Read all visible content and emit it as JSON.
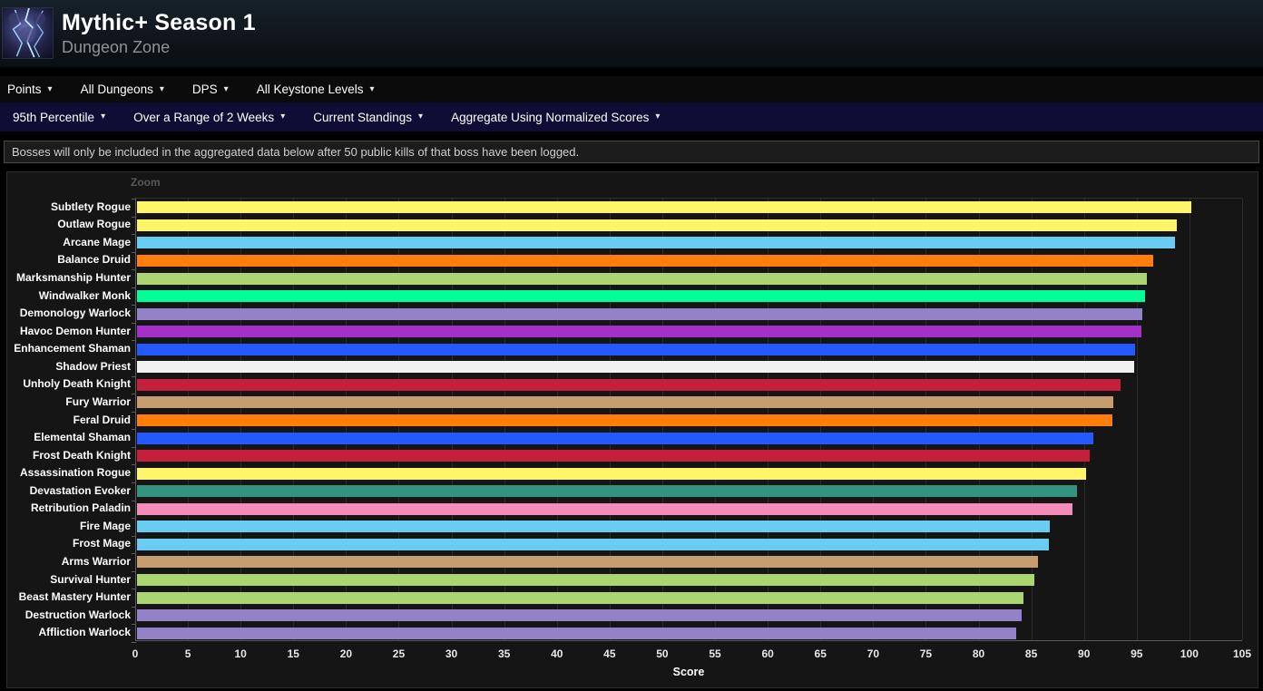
{
  "header": {
    "title": "Mythic+ Season 1",
    "subtitle": "Dungeon Zone"
  },
  "filters_row1": [
    {
      "label": "Points"
    },
    {
      "label": "All Dungeons"
    },
    {
      "label": "DPS"
    },
    {
      "label": "All Keystone Levels"
    }
  ],
  "filters_row2": [
    {
      "label": "95th Percentile"
    },
    {
      "label": "Over a Range of 2 Weeks"
    },
    {
      "label": "Current Standings"
    },
    {
      "label": "Aggregate Using Normalized Scores"
    }
  ],
  "notice": "Bosses will only be included in the aggregated data below after 50 public kills of that boss have been logged.",
  "chart": {
    "zoom_label": "Zoom"
  },
  "chart_data": {
    "type": "bar",
    "orientation": "horizontal",
    "title": "",
    "xlabel": "Score",
    "xlim": [
      0,
      105
    ],
    "xticks": [
      0,
      5,
      10,
      15,
      20,
      25,
      30,
      35,
      40,
      45,
      50,
      55,
      60,
      65,
      70,
      75,
      80,
      85,
      90,
      95,
      100,
      105
    ],
    "grid": true,
    "categories": [
      "Subtlety Rogue",
      "Outlaw Rogue",
      "Arcane Mage",
      "Balance Druid",
      "Marksmanship Hunter",
      "Windwalker Monk",
      "Demonology Warlock",
      "Havoc Demon Hunter",
      "Enhancement Shaman",
      "Shadow Priest",
      "Unholy Death Knight",
      "Fury Warrior",
      "Feral Druid",
      "Elemental Shaman",
      "Frost Death Knight",
      "Assassination Rogue",
      "Devastation Evoker",
      "Retribution Paladin",
      "Fire Mage",
      "Frost Mage",
      "Arms Warrior",
      "Survival Hunter",
      "Beast Mastery Hunter",
      "Destruction Warlock",
      "Affliction Warlock"
    ],
    "values": [
      100.0,
      98.6,
      98.5,
      96.4,
      95.8,
      95.6,
      95.4,
      95.3,
      94.7,
      94.6,
      93.3,
      92.6,
      92.5,
      90.7,
      90.4,
      90.0,
      89.2,
      88.7,
      86.6,
      86.5,
      85.5,
      85.1,
      84.1,
      83.9,
      83.4
    ],
    "colors": [
      "#fff569",
      "#fff569",
      "#69ccf0",
      "#ff7d0a",
      "#abd473",
      "#00ff98",
      "#9482c9",
      "#a330c9",
      "#2459ff",
      "#f0f0f0",
      "#c41f3b",
      "#c79c6e",
      "#ff7d0a",
      "#2459ff",
      "#c41f3b",
      "#fff569",
      "#33937f",
      "#f48cba",
      "#69ccf0",
      "#69ccf0",
      "#c79c6e",
      "#abd473",
      "#abd473",
      "#9482c9",
      "#9482c9"
    ]
  }
}
